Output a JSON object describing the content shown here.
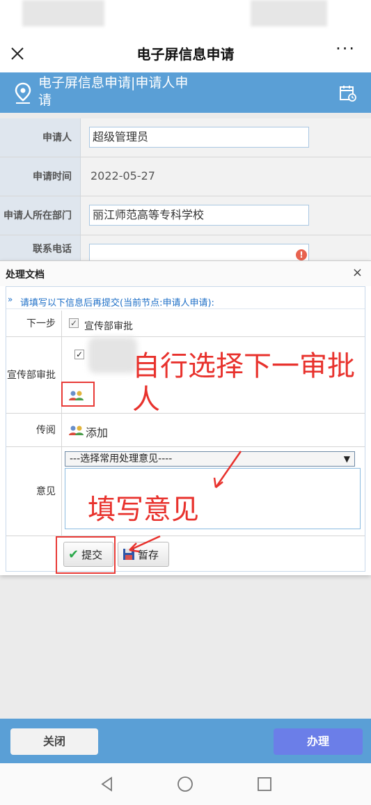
{
  "nav": {
    "title": "电子屏信息申请",
    "more": "···"
  },
  "banner": {
    "title": "电子屏信息申请|申请人申请"
  },
  "form": {
    "applicant_label": "申请人",
    "applicant_value": "超级管理员",
    "apply_time_label": "申请时间",
    "apply_time_value": "2022-05-27",
    "department_label": "申请人所在部门",
    "department_value": "丽江师范高等专科学校",
    "phone_label": "联系电话",
    "phone_value": ""
  },
  "dialog": {
    "title": "处理文档",
    "close": "×",
    "hint": "请填写以下信息后再提交(当前节点:申请人申请):",
    "next_step_label": "下一步",
    "next_step_option": "宣传部审批",
    "approver_label": "宣传部审批",
    "circulate_label": "传阅",
    "circulate_add": "添加",
    "opinion_label": "意见",
    "opinion_select": "---选择常用处理意见----",
    "opinion_text": "",
    "submit_label": "提交",
    "save_label": "暂存"
  },
  "annotations": {
    "choose_approver": "自行选择下一审批人",
    "fill_opinion": "填写意见"
  },
  "footer": {
    "close_label": "关闭",
    "handle_label": "办理"
  },
  "colors": {
    "banner": "#5a9fd6",
    "annotation_red": "#e8322d",
    "handle_button": "#6b7ee8"
  }
}
